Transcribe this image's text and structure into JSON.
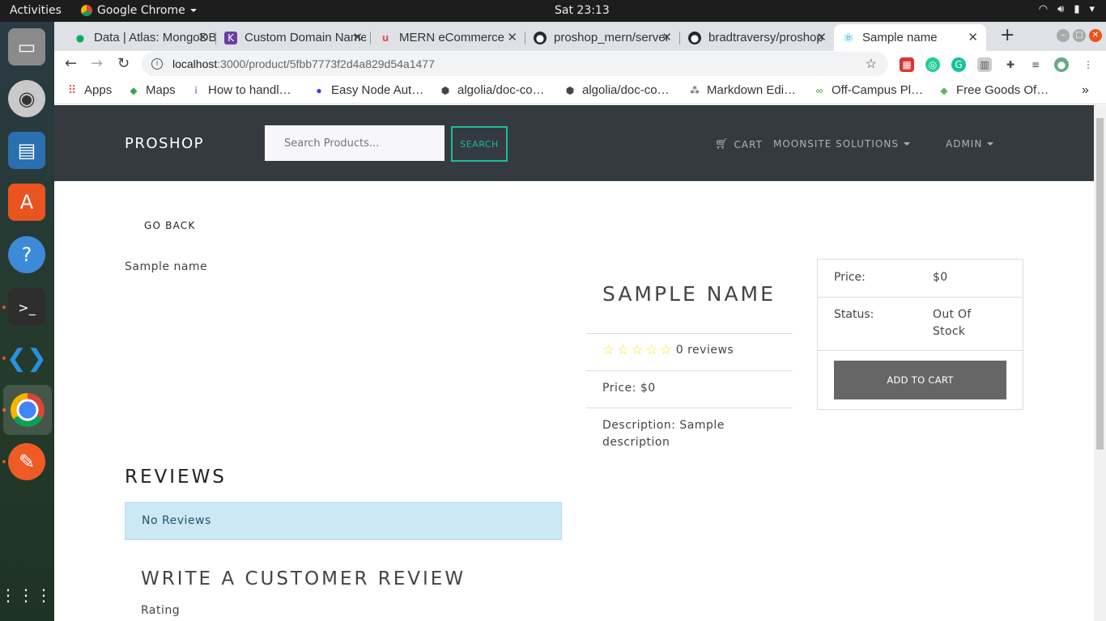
{
  "topbar": {
    "activities": "Activities",
    "app_name": "Google Chrome",
    "clock": "Sat 23:13"
  },
  "dock": {
    "items": [
      "file-manager",
      "rhythmbox",
      "libreoffice-writer",
      "software-center",
      "help",
      "terminal",
      "vscode",
      "google-chrome",
      "postman",
      "show-applications"
    ]
  },
  "tabs": [
    {
      "title": "Data | Atlas: MongoDB",
      "icon": "mongodb-leaf-icon",
      "color": "#13aa52"
    },
    {
      "title": "Custom Domain Names",
      "icon": "kinsta-icon",
      "color": "#6b3fa0"
    },
    {
      "title": "MERN eCommerce",
      "icon": "udemy-icon",
      "color": "#ec5252"
    },
    {
      "title": "proshop_mern/server",
      "icon": "github-icon",
      "color": "#24292e"
    },
    {
      "title": "bradtraversy/proshop",
      "icon": "github-icon",
      "color": "#24292e"
    },
    {
      "title": "Sample name",
      "icon": "react-icon",
      "color": "#00a8d6",
      "active": true
    }
  ],
  "omnibox": {
    "host": "localhost",
    "path": ":3000/product/5fbb7773f2d4a829d54a1477"
  },
  "bookmarks": [
    {
      "label": "Apps",
      "icon": "apps-grid-icon"
    },
    {
      "label": "Maps",
      "icon": "maps-icon"
    },
    {
      "label": "How to handl…",
      "icon": "hashnode-icon"
    },
    {
      "label": "Easy Node Aut…",
      "icon": "easy-node-icon"
    },
    {
      "label": "algolia/doc-co…",
      "icon": "cube-icon"
    },
    {
      "label": "algolia/doc-co…",
      "icon": "cube-icon"
    },
    {
      "label": "Markdown Edi…",
      "icon": "markdown-icon"
    },
    {
      "label": "Off-Campus Pl…",
      "icon": "offcampus-icon"
    },
    {
      "label": "Free Goods Of…",
      "icon": "tag-icon"
    }
  ],
  "site": {
    "brand": "PROSHOP",
    "search_placeholder": "Search Products...",
    "search_button": "SEARCH",
    "cart": "CART",
    "user": "MOONSITE SOLUTIONS",
    "admin": "ADMIN"
  },
  "product": {
    "go_back": "GO BACK",
    "image_alt": "Sample name",
    "name": "SAMPLE NAME",
    "rating": 0,
    "reviews_text": "0 reviews",
    "price_line": "Price: $0",
    "description_line": "Description: Sample description"
  },
  "card": {
    "price_label": "Price:",
    "price_value": "$0",
    "status_label": "Status:",
    "status_value": "Out Of Stock",
    "add_to_cart": "ADD TO CART"
  },
  "reviews": {
    "heading": "REVIEWS",
    "empty_message": "No Reviews",
    "write_heading": "WRITE A CUSTOMER REVIEW",
    "rating_label": "Rating"
  }
}
